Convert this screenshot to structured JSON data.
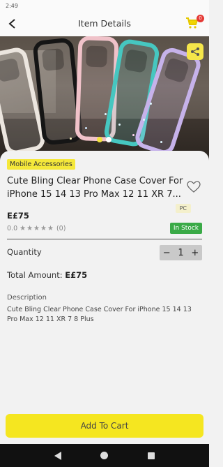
{
  "status": {
    "time": "2:49"
  },
  "app_bar": {
    "title": "Item Details",
    "cart_count": "0"
  },
  "hero": {
    "slide_count": 2,
    "active_slide": 1
  },
  "product": {
    "category": "Mobile Accessories",
    "title": "Cute Bling Clear Phone Case Cover For iPhone 15 14 13 Pro Max 12 11 XR 7...",
    "price": "E£75",
    "tag": "PC",
    "rating_value": "0.0",
    "stars": "★★★★★",
    "review_count": "(0)",
    "stock_status": "In Stock"
  },
  "quantity": {
    "label": "Quantity",
    "minus": "−",
    "value": "1",
    "plus": "+"
  },
  "total": {
    "label": "Total Amount:",
    "value": "E£75"
  },
  "description": {
    "label": "Description",
    "text": "Cute Bling Clear Phone Case Cover For iPhone 15 14 13 Pro Max 12 11 XR 7 8 Plus"
  },
  "cta": {
    "add_to_cart": "Add To Cart"
  },
  "colors": {
    "accent": "#f5e620",
    "in_stock": "#3aaa47",
    "badge": "#e53935"
  },
  "icons": [
    "back-arrow-icon",
    "cart-icon",
    "share-icon",
    "heart-icon",
    "nav-back-icon",
    "nav-home-icon",
    "nav-recent-icon"
  ]
}
